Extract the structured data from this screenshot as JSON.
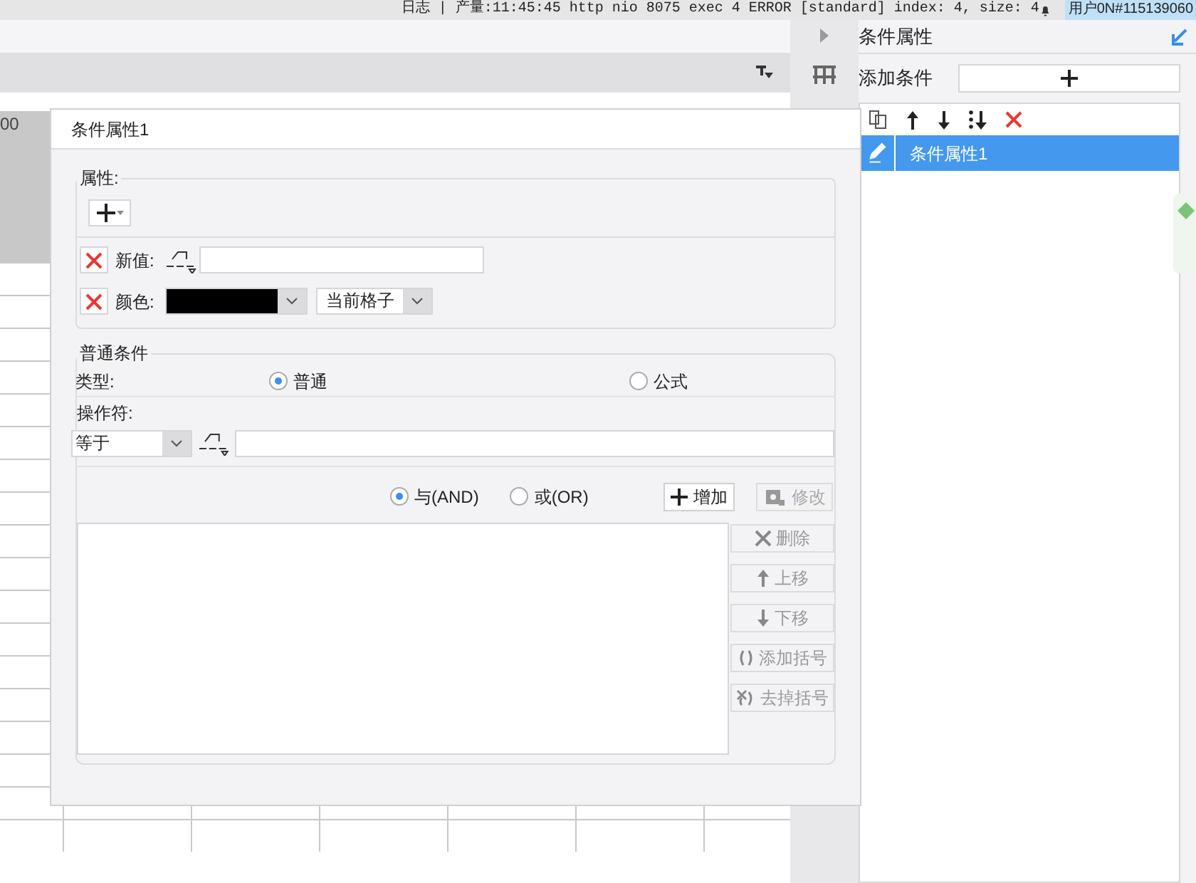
{
  "status_bar": {
    "log": "日志 | 产量:11:45:45 http nio 8075 exec 4 ERROR [standard] index: 4, size: 4",
    "user": "用户0N#115139060"
  },
  "ruler": {
    "label": "00"
  },
  "dialog": {
    "title": "条件属性1",
    "properties": {
      "legend": "属性:",
      "rows": [
        {
          "kind": "text",
          "label": "新值:"
        },
        {
          "kind": "color",
          "label": "颜色:",
          "color": "#000000",
          "scope": "当前格子"
        }
      ]
    },
    "condition": {
      "legend": "普通条件",
      "type_label": "类型:",
      "types": [
        {
          "label": "普通",
          "selected": true
        },
        {
          "label": "公式",
          "selected": false
        }
      ],
      "operator_label": "操作符:",
      "operator": "等于",
      "logic": [
        {
          "label": "与(AND)",
          "selected": true
        },
        {
          "label": "或(OR)",
          "selected": false
        }
      ],
      "buttons": [
        {
          "kind": "add",
          "label": "增加",
          "disabled": false
        },
        {
          "kind": "edit",
          "label": "修改",
          "disabled": true
        }
      ],
      "side_buttons": [
        {
          "kind": "delete",
          "label": "删除",
          "disabled": true
        },
        {
          "kind": "up",
          "label": "上移",
          "disabled": true
        },
        {
          "kind": "down",
          "label": "下移",
          "disabled": true
        },
        {
          "kind": "add_paren",
          "label": "添加括号",
          "disabled": true
        },
        {
          "kind": "remove_paren",
          "label": "去掉括号",
          "disabled": true
        }
      ]
    }
  },
  "panel": {
    "title": "条件属性",
    "add_label": "添加条件",
    "items": [
      {
        "label": "条件属性1",
        "selected": true
      }
    ]
  }
}
